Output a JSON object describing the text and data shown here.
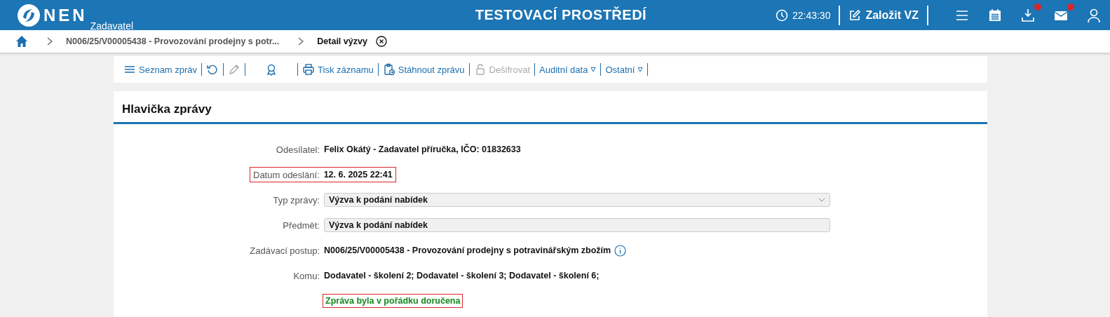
{
  "header": {
    "logo": "NEN",
    "logo_sub": "Zadavatel",
    "environment": "TESTOVACÍ PROSTŘEDÍ",
    "time": "22:43:30",
    "create_button": "Založit VZ",
    "icons": [
      {
        "kind": "menu",
        "badge": false
      },
      {
        "kind": "calendar",
        "badge": false
      },
      {
        "kind": "download",
        "badge": true
      },
      {
        "kind": "mail",
        "badge": true
      },
      {
        "kind": "user",
        "badge": false
      }
    ]
  },
  "breadcrumb": [
    {
      "label": "N006/25/V00005438 - Provozování prodejny s potr...",
      "current": false
    },
    {
      "label": "Detail výzvy",
      "current": true
    }
  ],
  "toolbar": [
    {
      "kind": "menu",
      "label": "Seznam zpráv",
      "disabled": false
    },
    {
      "kind": "refresh",
      "disabled": false
    },
    {
      "kind": "pencil",
      "disabled": true
    },
    {
      "kind": "award",
      "disabled": false
    },
    {
      "kind": "print",
      "label": "Tisk záznamu",
      "disabled": false
    },
    {
      "kind": "clipboard",
      "label": "Stáhnout zprávu",
      "disabled": false
    },
    {
      "kind": "unlock",
      "label": "Dešifrovat",
      "disabled": true
    },
    {
      "kind": "dropdown",
      "label": "Auditní data",
      "disabled": false
    },
    {
      "kind": "dropdown",
      "label": "Ostatní",
      "disabled": false
    }
  ],
  "section": {
    "title": "Hlavička zprávy",
    "fields": [
      {
        "kind": "text",
        "label": "Odesílatel:",
        "value": "Felix Okátý - Zadavatel příručka, IČO: 01832633",
        "highlighted": false
      },
      {
        "kind": "text",
        "label": "Datum odeslání:",
        "value": "12. 6. 2025 22:41",
        "highlighted": true
      },
      {
        "kind": "select",
        "label": "Typ zprávy:",
        "value": "Výzva k podání nabídek",
        "highlighted": false
      },
      {
        "kind": "input",
        "label": "Předmět:",
        "value": "Výzva k podání nabídek",
        "highlighted": false
      },
      {
        "kind": "info",
        "label": "Zadávací postup:",
        "value": "N006/25/V00005438 - Provozování prodejny s potravinářským zbožím",
        "highlighted": false
      },
      {
        "kind": "text",
        "label": "Komu:",
        "value": "Dodavatel - školení 2; Dodavatel - školení 3; Dodavatel - školení 6;",
        "highlighted": false
      },
      {
        "kind": "status",
        "value": "Zpráva byla v pořádku doručena",
        "highlighted": true
      }
    ]
  }
}
